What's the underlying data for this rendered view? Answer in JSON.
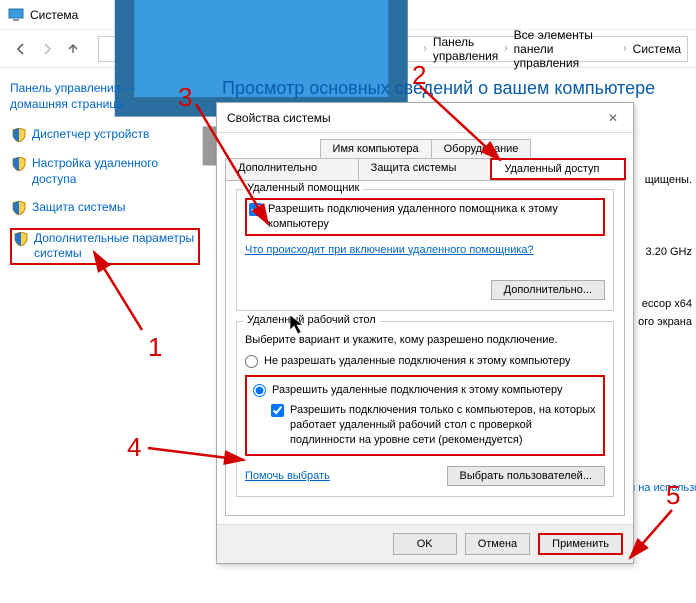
{
  "window": {
    "title": "Система"
  },
  "breadcrumb": {
    "b1": "Панель управления",
    "b2": "Все элементы панели управления",
    "b3": "Система"
  },
  "sidebar": {
    "home_l1": "Панель управления —",
    "home_l2": "домашняя страница",
    "items": [
      "Диспетчер устройств",
      "Настройка удаленного доступа",
      "Защита системы",
      "Дополнительные параметры системы"
    ]
  },
  "page": {
    "title": "Просмотр основных сведений о вашем компьютере"
  },
  "dialog": {
    "title": "Свойства системы",
    "tabs": {
      "t0": "Имя компьютера",
      "t1": "Оборудование",
      "t2": "Дополнительно",
      "t3": "Защита системы",
      "t4": "Удаленный доступ"
    },
    "ra": {
      "group": "Удаленный помощник",
      "allow": "Разрешить подключения удаленного помощника к этому компьютеру",
      "link": "Что происходит при включении удаленного помощника?",
      "adv": "Дополнительно..."
    },
    "rd": {
      "group": "Удаленный рабочий стол",
      "hint": "Выберите вариант и укажите, кому разрешено подключение.",
      "opt_no": "Не разрешать удаленные подключения к этому компьютеру",
      "opt_yes": "Разрешить удаленные подключения к этому компьютеру",
      "nla": "Разрешить подключения только с компьютеров, на которых работает удаленный рабочий стол с проверкой подлинности на уровне сети (рекомендуется)",
      "help": "Помочь выбрать",
      "select_users": "Выбрать пользователей..."
    },
    "buttons": {
      "ok": "OK",
      "cancel": "Отмена",
      "apply": "Применить"
    }
  },
  "bg": {
    "t1": "щищены.",
    "t2": "3.20 GHz",
    "t3": "ессор x64",
    "t4": "ого экрана",
    "t5": "я на использов"
  },
  "anno": {
    "n1": "1",
    "n2": "2",
    "n3": "3",
    "n4": "4",
    "n5": "5"
  }
}
